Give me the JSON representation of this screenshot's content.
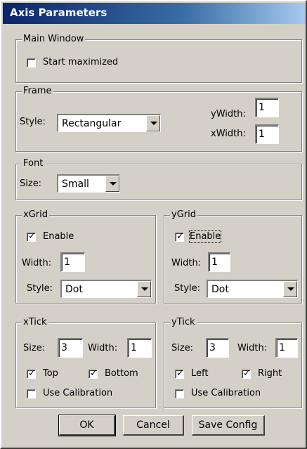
{
  "window": {
    "title": "Axis Parameters"
  },
  "main_window": {
    "legend": "Main Window",
    "start_maximized": {
      "label": "Start maximized",
      "checked": false
    }
  },
  "frame": {
    "legend": "Frame",
    "style_label": "Style:",
    "style_value": "Rectangular",
    "ywidth_label": "yWidth:",
    "ywidth_value": "1",
    "xwidth_label": "xWidth:",
    "xwidth_value": "1"
  },
  "font": {
    "legend": "Font",
    "size_label": "Size:",
    "size_value": "Small"
  },
  "xgrid": {
    "legend": "xGrid",
    "enable_label": "Enable",
    "enable_checked": true,
    "width_label": "Width:",
    "width_value": "1",
    "style_label": "Style:",
    "style_value": "Dot"
  },
  "ygrid": {
    "legend": "yGrid",
    "enable_label": "Enable",
    "enable_checked": true,
    "width_label": "Width:",
    "width_value": "1",
    "style_label": "Style:",
    "style_value": "Dot"
  },
  "xtick": {
    "legend": "xTick",
    "size_label": "Size:",
    "size_value": "3",
    "width_label": "Width:",
    "width_value": "1",
    "top_label": "Top",
    "top_checked": true,
    "bottom_label": "Bottom",
    "bottom_checked": true,
    "calib_label": "Use Calibration",
    "calib_checked": false
  },
  "ytick": {
    "legend": "yTick",
    "size_label": "Size:",
    "size_value": "3",
    "width_label": "Width:",
    "width_value": "1",
    "left_label": "Left",
    "left_checked": true,
    "right_label": "Right",
    "right_checked": true,
    "calib_label": "Use Calibration",
    "calib_checked": false
  },
  "buttons": {
    "ok": "OK",
    "cancel": "Cancel",
    "save": "Save Config"
  }
}
